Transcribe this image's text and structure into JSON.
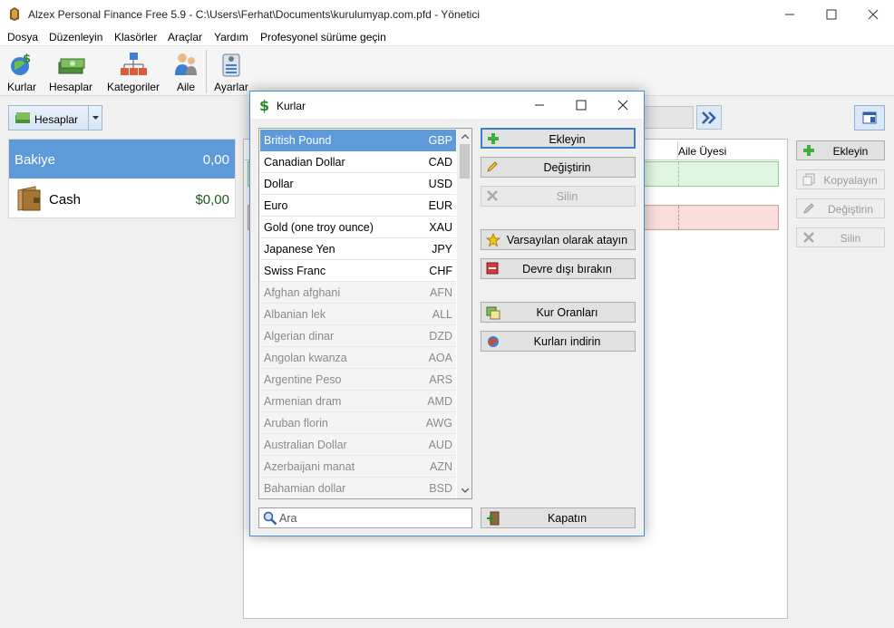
{
  "window": {
    "title": "Alzex Personal Finance Free 5.9 - C:\\Users\\Ferhat\\Documents\\kurulumyap.com.pfd - Yönetici"
  },
  "menu": [
    "Dosya",
    "Düzenleyin",
    "Klasörler",
    "Araçlar",
    "Yardım",
    "Profesyonel sürüme geçin"
  ],
  "toolbar": {
    "currencies": "Kurlar",
    "accounts": "Hesaplar",
    "categories": "Kategoriler",
    "family": "Aile",
    "settings": "Ayarlar"
  },
  "accounts_combo": {
    "label": "Hesaplar"
  },
  "accounts": {
    "balance_label": "Bakiye",
    "balance_value": "0,00",
    "cash_label": "Cash",
    "cash_value": "$0,00"
  },
  "grid": {
    "family_member_header": "Aile Üyesi"
  },
  "side_buttons": {
    "add": "Ekleyin",
    "copy": "Kopyalayın",
    "edit": "Değiştirin",
    "delete": "Silin"
  },
  "dialog": {
    "title": "Kurlar",
    "currencies": [
      {
        "name": "British Pound",
        "code": "GBP",
        "state": "selected"
      },
      {
        "name": "Canadian Dollar",
        "code": "CAD",
        "state": "active"
      },
      {
        "name": "Dollar",
        "code": "USD",
        "state": "active"
      },
      {
        "name": "Euro",
        "code": "EUR",
        "state": "active"
      },
      {
        "name": "Gold (one troy ounce)",
        "code": "XAU",
        "state": "active"
      },
      {
        "name": "Japanese Yen",
        "code": "JPY",
        "state": "active"
      },
      {
        "name": "Swiss Franc",
        "code": "CHF",
        "state": "active"
      },
      {
        "name": "Afghan afghani",
        "code": "AFN",
        "state": "inactive"
      },
      {
        "name": "Albanian lek",
        "code": "ALL",
        "state": "inactive"
      },
      {
        "name": "Algerian dinar",
        "code": "DZD",
        "state": "inactive"
      },
      {
        "name": "Angolan kwanza",
        "code": "AOA",
        "state": "inactive"
      },
      {
        "name": "Argentine Peso",
        "code": "ARS",
        "state": "inactive"
      },
      {
        "name": "Armenian dram",
        "code": "AMD",
        "state": "inactive"
      },
      {
        "name": "Aruban florin",
        "code": "AWG",
        "state": "inactive"
      },
      {
        "name": "Australian Dollar",
        "code": "AUD",
        "state": "inactive"
      },
      {
        "name": "Azerbaijani manat",
        "code": "AZN",
        "state": "inactive"
      },
      {
        "name": "Bahamian dollar",
        "code": "BSD",
        "state": "inactive"
      }
    ],
    "buttons": {
      "add": "Ekleyin",
      "edit": "Değiştirin",
      "delete": "Silin",
      "set_default": "Varsayılan olarak atayın",
      "disable": "Devre dışı bırakın",
      "rates": "Kur Oranları",
      "download": "Kurları indirin",
      "close": "Kapatın"
    },
    "search_placeholder": "Ara"
  }
}
